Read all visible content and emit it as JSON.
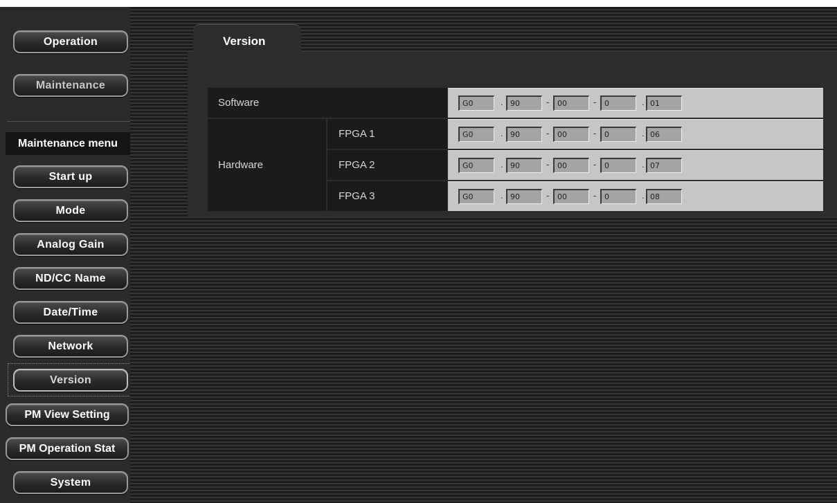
{
  "nav": {
    "operation": "Operation",
    "maintenance": "Maintenance",
    "menu_header": "Maintenance menu",
    "items": [
      "Start up",
      "Mode",
      "Analog Gain",
      "ND/CC Name",
      "Date/Time",
      "Network",
      "Version",
      "PM View Setting",
      "PM Operation Stat",
      "System"
    ],
    "active_item": "Version"
  },
  "tab": {
    "label": "Version"
  },
  "version_table": {
    "software_label": "Software",
    "hardware_label": "Hardware",
    "separators": {
      "dot": ".",
      "dash": "-"
    },
    "rows": [
      {
        "name": "",
        "fields": [
          "G0",
          "90",
          "00",
          "0",
          "01"
        ]
      },
      {
        "name": "FPGA 1",
        "fields": [
          "G0",
          "90",
          "00",
          "0",
          "06"
        ]
      },
      {
        "name": "FPGA 2",
        "fields": [
          "G0",
          "90",
          "00",
          "0",
          "07"
        ]
      },
      {
        "name": "FPGA 3",
        "fields": [
          "G0",
          "90",
          "00",
          "0",
          "08"
        ]
      }
    ]
  }
}
